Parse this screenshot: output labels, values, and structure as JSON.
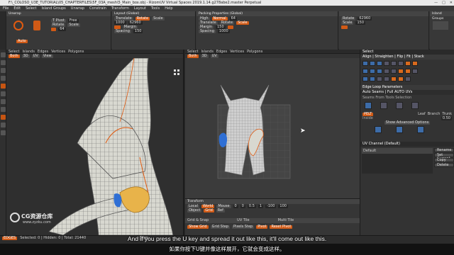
{
  "title_bar": {
    "title": "F:\\_COLOSO_U3E_TUTORIAL\\05_CHAPTERFILES\\5F_03A_mesh\\5_Main_box.obj - RizomUV Virtual Spaces 2019.1.14.g278abe2.master Perpetual"
  },
  "menu": [
    "File",
    "Edit",
    "Select",
    "Island Groups",
    "Unwrap",
    "Constrain",
    "Transform",
    "Layout",
    "Tools",
    "Help"
  ],
  "ribbon": {
    "unwrap_label": "Unwrap",
    "unwrap_btn": "Auto",
    "layout_label": "Layout (Global)",
    "packing_label": "Packing Properties (Global)",
    "island_groups_label": "Island Groups",
    "packing_values": [
      "64",
      "1000",
      "62960",
      "150"
    ],
    "layout_fields": [
      "T Pivot",
      "Free",
      "Rotate",
      "Scale"
    ],
    "packing_fields": [
      "Translate",
      "Rotate",
      "Scale",
      "Margin",
      "Spacing"
    ],
    "quality_options": [
      "High",
      "Normal"
    ]
  },
  "left_tools": [
    "select",
    "move",
    "rotate",
    "scale",
    "cut",
    "weld",
    "seam",
    "pin",
    "island",
    "zoom",
    "frame"
  ],
  "viewport3d": {
    "tabs": [
      "Select",
      "Islands",
      "Edges",
      "Vertices",
      "Polygons"
    ],
    "toggles": [
      "Both",
      "3D",
      "UV",
      "View"
    ]
  },
  "viewport_uv": {
    "tabs": [
      "Select",
      "Islands",
      "Edges",
      "Vertices",
      "Polygons"
    ],
    "toggles": [
      "Both",
      "3D",
      "UV"
    ]
  },
  "right_panel": {
    "select_label": "Select",
    "align_label": "Align | Straighten | Flip | Fit | Stack",
    "edge_loop_label": "Edge Loop Parameters",
    "auto_seams_label": "Auto Seams | Full AUTO UVs",
    "auto_seams_sub": "Seams From Tools Selection",
    "pelt_label": "PELT",
    "leaf_label": "Leaf",
    "branch_label": "Branch",
    "trunk_label": "Trunk",
    "show_advanced": "Show Advanced Options",
    "uv_channel_label": "UV Channel (Default)",
    "uv_channel_value": "Default",
    "uv_buttons": [
      "Rename",
      "Set Current",
      "Copy",
      "Delete"
    ],
    "field_values": [
      "Inside",
      "0.50"
    ]
  },
  "transform_panel": {
    "title": "Transform",
    "grid_snap": "Grid & Snap",
    "uv_tile": "UV Tile",
    "multi_tile": "Multi Tile",
    "rows": [
      [
        "Local",
        "World",
        "Mouse"
      ],
      [
        "Object",
        "Grid",
        "Ref"
      ]
    ],
    "values": [
      "0",
      "0",
      "0.5",
      "1",
      "-100",
      "100"
    ],
    "snap_buttons": [
      "Show Grid",
      "Grid Step",
      "Pixels Step"
    ],
    "orange_buttons": [
      "Pivot",
      "Reset Pivot"
    ]
  },
  "status": {
    "edges": "EDGES",
    "stats": "Selected: 0 | Hidden: 0 | Total: 21440",
    "tool": "Tiles",
    "scale_items": [
      "100",
      "75",
      "50",
      "25",
      "10",
      "5",
      "1"
    ]
  },
  "watermark": {
    "name": "CG资源仓库",
    "url": "www.zyzku.com"
  },
  "subtitle": {
    "english": "And if you press the U key and spread it out like this, it'll come out like this.",
    "chinese": "如果你按下U键并像这样展开，它就会变成这样。"
  },
  "colors": {
    "accent": "#e05a10",
    "island_blue": "#2f6fd4",
    "island_orange": "#e8b34a",
    "background": "#2b2b2b",
    "uv_bg": "#3b3b3b"
  }
}
